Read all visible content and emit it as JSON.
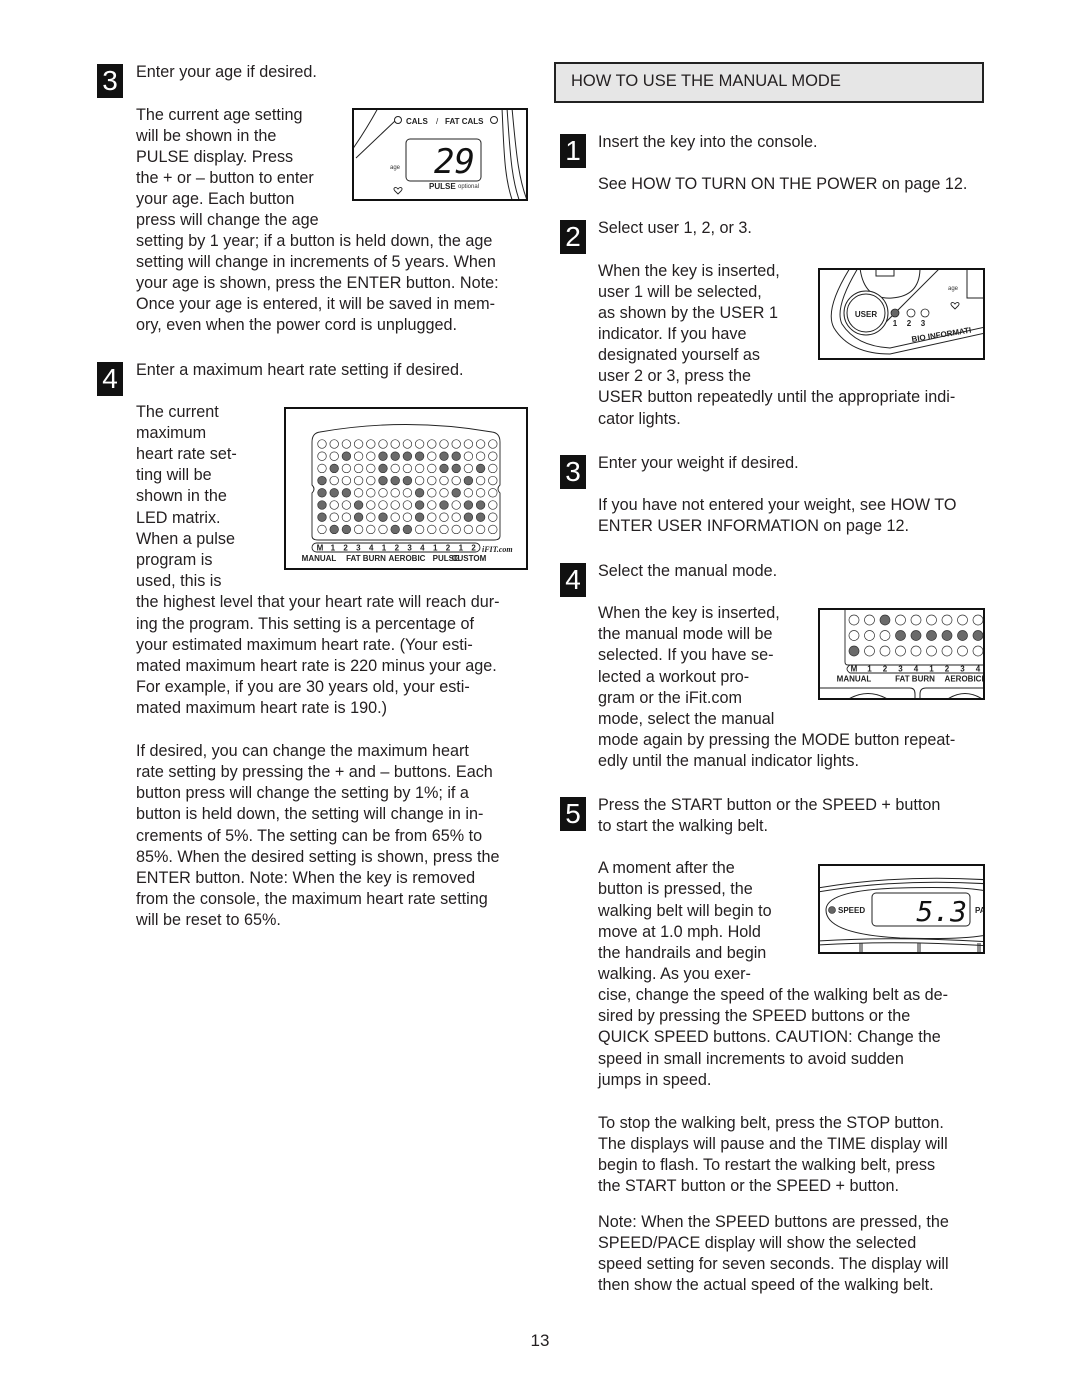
{
  "page_number": "13",
  "left_column": {
    "step3": {
      "number": "3",
      "title": "Enter your age if desired.",
      "wrapped_lines": [
        "The current age setting",
        "will be shown in the",
        "PULSE display. Press",
        "the + or – button to enter",
        "your age. Each button",
        "press will change the age"
      ],
      "full_lines": [
        "setting by 1 year; if a button is held down, the age",
        "setting will change in increments of 5 years. When",
        "your age is shown, press the ENTER button. Note:",
        "Once your age is entered, it will be saved in mem-",
        "ory, even when the power cord is unplugged."
      ],
      "figure": {
        "cals_label": "CALS",
        "separator": "/",
        "fat_cals_label": "FAT CALS",
        "age_label": "age",
        "display_value": "29",
        "pulse_label": "PULSE",
        "optional_label": "optional"
      }
    },
    "step4": {
      "number": "4",
      "title": "Enter a maximum heart rate setting if desired.",
      "wrapped_lines": [
        "The current",
        "maximum",
        "heart rate set-",
        "ting will be",
        "shown in the",
        "LED matrix.",
        "When a pulse",
        "program is",
        "used, this is"
      ],
      "full_lines": [
        "the highest level that your heart rate will reach dur-",
        "ing the program. This setting is a percentage of",
        "your estimated maximum heart rate. (Your esti-",
        "mated maximum heart rate is 220 minus your age.",
        "For example, if you are 30 years old, your esti-",
        "mated maximum heart rate is 190.)"
      ],
      "paragraph2_lines": [
        "If desired, you can change the maximum heart",
        "rate setting by pressing the + and – buttons. Each",
        "button press will change the setting by 1%; if a",
        "button is held down, the setting will change in in-",
        "crements of 5%. The setting can be from 65% to",
        "85%. When the desired setting is shown, press the",
        "ENTER button. Note: When the key is removed",
        "from the console, the maximum heart rate setting",
        "will be reset to 65%."
      ],
      "figure": {
        "matrix": [
          [
            0,
            0,
            0,
            0,
            0,
            0,
            0,
            0,
            0,
            0,
            0,
            0,
            0,
            0,
            0
          ],
          [
            0,
            0,
            1,
            0,
            0,
            1,
            1,
            1,
            1,
            0,
            1,
            1,
            0,
            0,
            0
          ],
          [
            0,
            1,
            0,
            0,
            0,
            1,
            0,
            0,
            0,
            0,
            1,
            1,
            0,
            1,
            0
          ],
          [
            1,
            0,
            0,
            0,
            0,
            1,
            1,
            1,
            0,
            0,
            0,
            0,
            1,
            0,
            0
          ],
          [
            1,
            1,
            1,
            0,
            0,
            0,
            0,
            0,
            1,
            0,
            0,
            1,
            0,
            0,
            0
          ],
          [
            1,
            0,
            0,
            1,
            0,
            0,
            0,
            0,
            1,
            0,
            1,
            0,
            1,
            1,
            0
          ],
          [
            1,
            0,
            0,
            1,
            0,
            1,
            0,
            0,
            1,
            0,
            0,
            0,
            1,
            1,
            0
          ],
          [
            0,
            1,
            1,
            0,
            0,
            0,
            1,
            1,
            0,
            0,
            0,
            0,
            0,
            0,
            0
          ]
        ],
        "program_numbers": [
          "M",
          "1",
          "2",
          "3",
          "4",
          "1",
          "2",
          "3",
          "4",
          "1",
          "2",
          "1",
          "2"
        ],
        "program_groups": [
          "MANUAL",
          "FAT BURN",
          "AEROBIC",
          "PULSE",
          "CUSTOM"
        ],
        "logo": "iFIT.com"
      }
    }
  },
  "right_column": {
    "section_header": "HOW TO USE THE MANUAL MODE",
    "step1": {
      "number": "1",
      "title": "Insert the key into the console.",
      "body": "See HOW TO TURN ON THE POWER on page 12."
    },
    "step2": {
      "number": "2",
      "title": "Select user 1, 2, or 3.",
      "wrapped_lines": [
        "When the key is inserted,",
        "user 1 will be selected,",
        "as shown by the USER 1",
        "indicator. If you have",
        "designated yourself as",
        "user 2 or 3, press the"
      ],
      "full_lines": [
        "USER button repeatedly until the appropriate indi-",
        "cator lights."
      ],
      "figure": {
        "user_button": "USER",
        "user_numbers": [
          "1",
          "2",
          "3"
        ],
        "active_user": "1",
        "age_label": "age",
        "bio_label": "BIO INFORMATI"
      }
    },
    "step3": {
      "number": "3",
      "title": "Enter your weight if desired.",
      "lines": [
        "If you have not entered your weight, see HOW TO",
        "ENTER USER INFORMATION on page 12."
      ]
    },
    "step4": {
      "number": "4",
      "title": "Select the manual mode.",
      "wrapped_lines": [
        "When the key is inserted,",
        "the manual mode will be",
        "selected. If you have se-",
        "lected a workout pro-",
        "gram or the iFit.com",
        "mode, select the manual"
      ],
      "full_lines": [
        "mode again by pressing the MODE button repeat-",
        "edly until the manual indicator lights."
      ],
      "figure": {
        "matrix": [
          [
            0,
            0,
            1,
            0,
            0,
            0,
            0,
            0,
            0
          ],
          [
            0,
            0,
            0,
            1,
            1,
            1,
            1,
            1,
            1
          ],
          [
            1,
            0,
            0,
            0,
            0,
            0,
            0,
            0,
            0
          ]
        ],
        "program_numbers": [
          "M",
          "1",
          "2",
          "3",
          "4",
          "1",
          "2",
          "3",
          "4"
        ],
        "program_groups": [
          "MANUAL",
          "FAT BURN",
          "AEROBIC",
          "PU"
        ]
      }
    },
    "step5": {
      "number": "5",
      "title_lines": [
        "Press the START button or the SPEED + button",
        "to start the walking belt."
      ],
      "wrapped_lines": [
        "A moment after the",
        "button is pressed, the",
        "walking belt will begin to",
        "move at 1.0 mph. Hold",
        "the handrails and begin",
        "walking. As you exer-"
      ],
      "full_lines": [
        "cise, change the speed of the walking belt as de-",
        "sired by pressing the SPEED buttons or the",
        "QUICK SPEED buttons. CAUTION: Change the",
        "speed in small increments to avoid sudden",
        "jumps in speed."
      ],
      "paragraph2_lines": [
        "To stop the walking belt, press the STOP button.",
        "The displays will pause and the TIME display will",
        "begin to flash. To restart the walking belt, press",
        "the START button or the SPEED + button."
      ],
      "paragraph3_lines": [
        "Note: When the SPEED buttons are pressed, the",
        "SPEED/PACE display will show the selected",
        "speed setting for seven seconds. The display will",
        "then show the actual speed of the walking belt."
      ],
      "figure": {
        "speed_label": "SPEED",
        "display_value": "5.3",
        "pace_label": "PA"
      }
    }
  },
  "colors": {
    "text": "#231f20",
    "step_badge": "#111111",
    "header_fill": "#e6e6e6",
    "led_on": "#6a6a6a"
  }
}
